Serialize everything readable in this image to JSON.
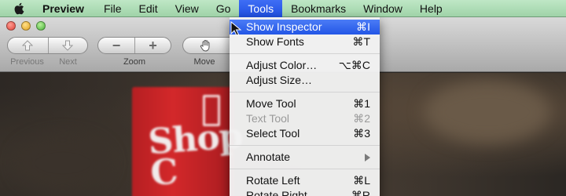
{
  "menubar": {
    "app_name": "Preview",
    "items": [
      "File",
      "Edit",
      "View",
      "Go",
      "Tools",
      "Bookmarks",
      "Window",
      "Help"
    ],
    "active_item": "Tools"
  },
  "toolbar": {
    "previous_label": "Previous",
    "next_label": "Next",
    "zoom_label": "Zoom",
    "zoom_out_glyph": "−",
    "zoom_in_glyph": "+",
    "move_label": "Move"
  },
  "tools_menu": {
    "groups": [
      [
        {
          "label": "Show Inspector",
          "shortcut": "⌘I",
          "highlighted": true
        },
        {
          "label": "Show Fonts",
          "shortcut": "⌘T"
        }
      ],
      [
        {
          "label": "Adjust Color…",
          "shortcut": "⌥⌘C"
        },
        {
          "label": "Adjust Size…",
          "shortcut": ""
        }
      ],
      [
        {
          "label": "Move Tool",
          "shortcut": "⌘1"
        },
        {
          "label": "Text Tool",
          "shortcut": "⌘2",
          "disabled": true
        },
        {
          "label": "Select Tool",
          "shortcut": "⌘3"
        }
      ],
      [
        {
          "label": "Annotate",
          "shortcut": "",
          "submenu": true
        }
      ],
      [
        {
          "label": "Rotate Left",
          "shortcut": "⌘L"
        },
        {
          "label": "Rotate Right",
          "shortcut": "⌘R"
        }
      ]
    ]
  },
  "document": {
    "sign_text": "Shop\nC"
  },
  "colors": {
    "menubar": "#a8d8b0",
    "menu_highlight": "#2f62ea",
    "sign_red": "#c8252a"
  }
}
